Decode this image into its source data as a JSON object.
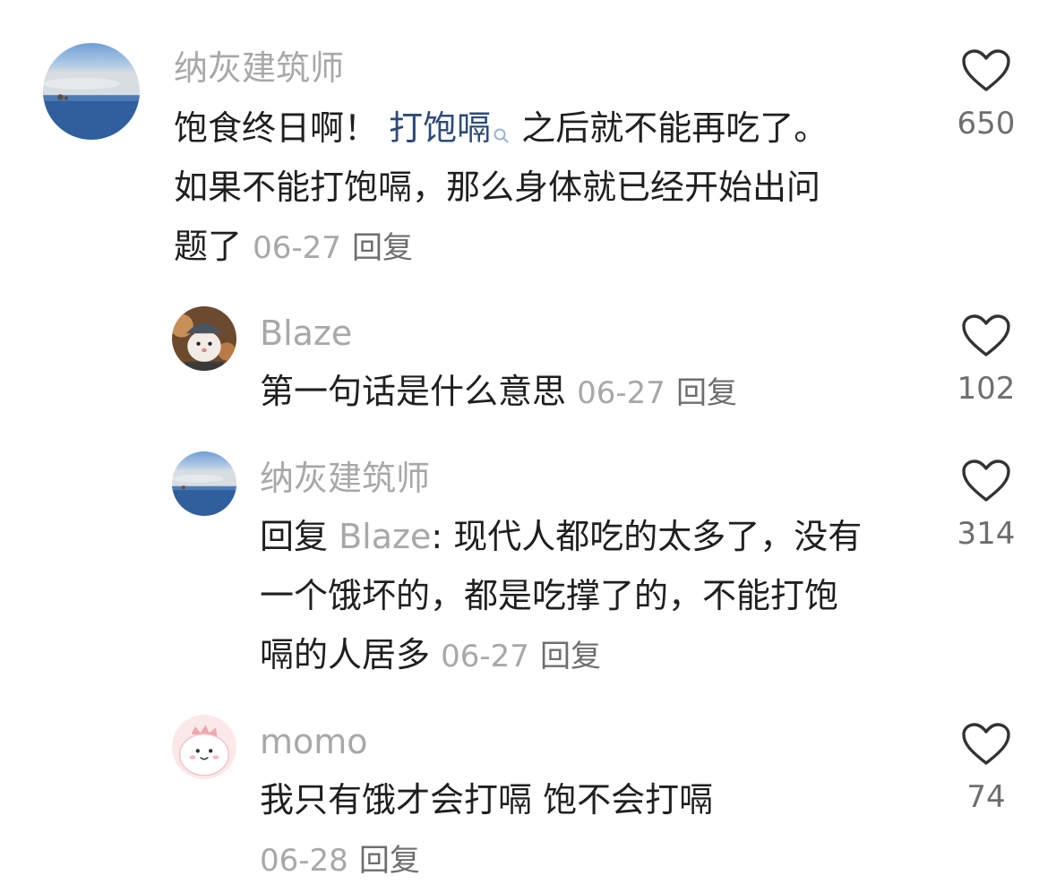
{
  "comments": [
    {
      "username": "纳灰建筑师",
      "text_before": "饱食终日啊！ ",
      "link": "打饱嗝",
      "text_after": " 之后就不能再吃了。",
      "line2": "如果不能打饱嗝，那么身体就已经开始出问",
      "line3": "题了",
      "date": "06-27",
      "reply_label": "回复",
      "likes": "650",
      "avatar": "sea-horizon"
    },
    {
      "username": "Blaze",
      "text": "第一句话是什么意思",
      "date": "06-27",
      "reply_label": "回复",
      "likes": "102",
      "avatar": "cat-with-helmet"
    },
    {
      "username": "纳灰建筑师",
      "reply_prefix": "回复 ",
      "mention": "Blaze",
      "line1_rest": ": 现代人都吃的太多了，没有",
      "line2": "一个饿坏的，都是吃撑了的，不能打饱",
      "line3": "嗝的人居多",
      "date": "06-27",
      "reply_label": "回复",
      "likes": "314",
      "avatar": "sea-horizon"
    },
    {
      "username": "momo",
      "text": "我只有饿才会打嗝 饱不会打嗝",
      "date": "06-28",
      "reply_label": "回复",
      "likes": "74",
      "avatar": "pink-dino"
    }
  ],
  "colors": {
    "muted": "#a8a8a8",
    "link": "#2c4a7a",
    "text": "#1f1f1f"
  }
}
